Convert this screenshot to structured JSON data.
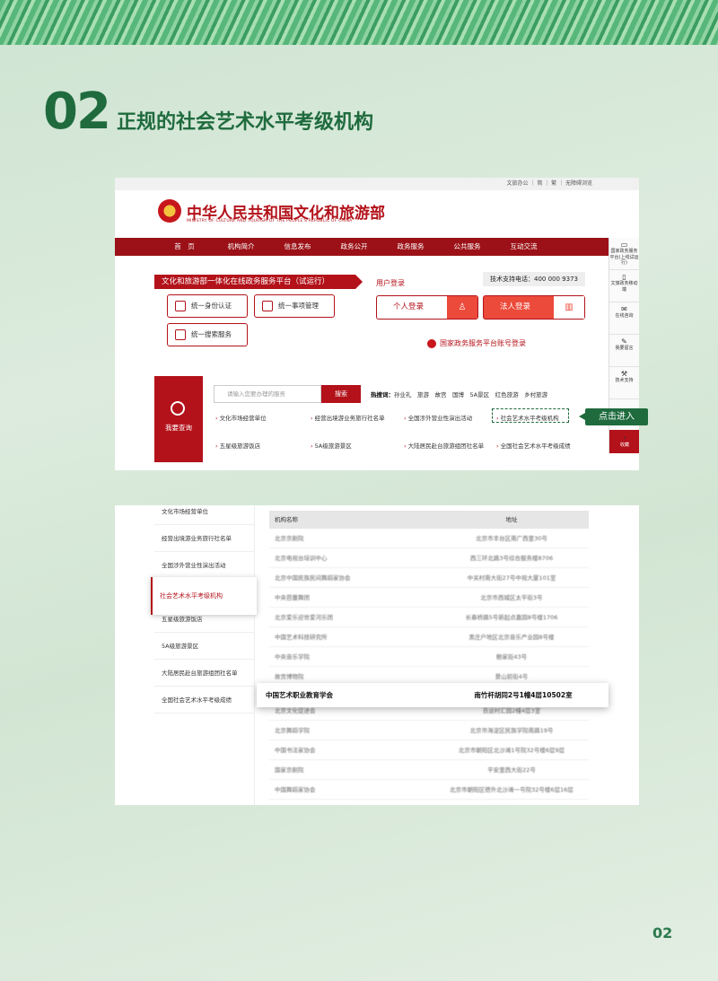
{
  "heading": {
    "number": "02",
    "title": "正规的社会艺术水平考级机构"
  },
  "page_number": "02",
  "site": {
    "util_links": "文旅办公 ｜ 简 ｜ 繁 ｜ 无障碍浏览",
    "title": "中华人民共和国文化和旅游部",
    "subtitle": "MINISTRY OF CULTURE AND TOURISM OF THE PEOPLE'S REPUBLIC OF CHINA",
    "nav": [
      "首　页",
      "机构简介",
      "信息发布",
      "政务公开",
      "政务服务",
      "公共服务",
      "互动交流"
    ],
    "sidebar": [
      {
        "icon": "▭",
        "label": "国家政务服务平台(上线试运行)"
      },
      {
        "icon": "▯",
        "label": "文旅政务移动端"
      },
      {
        "icon": "✉",
        "label": "在线咨询"
      },
      {
        "icon": "✎",
        "label": "我要留言"
      },
      {
        "icon": "⚒",
        "label": "技术支持"
      }
    ],
    "sidebar_fav": "收藏",
    "banner": "文化和旅游部一体化在线政务服务平台（试运行）",
    "services": [
      "统一身份认证",
      "统一事项管理",
      "统一搜索服务"
    ],
    "login_title": "用户登录",
    "tech_phone": "技术支持电话：400 000 9373",
    "login_personal": "个人登录",
    "login_corp": "法人登录",
    "gov_login": "国家政务服务平台账号登录",
    "query_label": "我要查询",
    "search_placeholder": "请输入您要办理的服务",
    "search_button": "搜索",
    "hot_label": "热搜词：",
    "hot_words": "孙业礼　旅游　故宫　国博　5A景区　红色旅游　乡村旅游",
    "quick_links": [
      "文化市场经营单位",
      "经营出境游业务旅行社名单",
      "全国涉外营业性演出活动",
      "社会艺术水平考级机构",
      "五星级旅游饭店",
      "5A级旅游景区",
      "大陆居民赴台旅游组团社名单",
      "全国社会艺术水平考级成绩"
    ],
    "callout": "点击进入"
  },
  "list": {
    "menu": [
      "文化市场经营单位",
      "经营出境游业务旅行社名单",
      "全国涉外营业性演出活动",
      "五星级旅游饭店",
      "5A级旅游景区",
      "大陆居民赴台旅游组团社名单",
      "全国社会艺术水平考级成绩"
    ],
    "menu_active": "社会艺术水平考级机构",
    "headers": [
      "机构名称",
      "地址"
    ],
    "rows": [
      [
        "北京京剧院",
        "北京市丰台区南广西里30号"
      ],
      [
        "北京电视台培训中心",
        "西三环北路3号综合服务楼8706"
      ],
      [
        "北京中国民族民间舞蹈家协会",
        "中关村南大街27号中视大厦101室"
      ],
      [
        "中央芭蕾舞团",
        "北京市西城区太平街3号"
      ],
      [
        "北京爱乐迎世爱河乐团",
        "长春桥路5号新起点嘉园8号楼1706"
      ],
      [
        "中国艺术科技研究所",
        "黑庄户地区北京音乐产业园8号楼"
      ],
      [
        "中央音乐学院",
        "鲍家街43号"
      ],
      [
        "故宫博物院",
        "景山前街4号"
      ],
      [
        "北京文化促进会",
        "百运村汇园2幢4层3室"
      ],
      [
        "北京舞蹈学院",
        "北京市海淀区民族学院南路19号"
      ],
      [
        "中国书法家协会",
        "北京市朝阳区北沙滩1号院32号楼6层9层"
      ],
      [
        "国家京剧院",
        "平安里西大街22号"
      ],
      [
        "中国舞蹈家协会",
        "北京市朝阳区德外北沙滩一号院32号楼6层16层"
      ]
    ],
    "highlight": [
      "中国艺术职业教育学会",
      "南竹杆胡同2号1幢4层10502室"
    ]
  }
}
